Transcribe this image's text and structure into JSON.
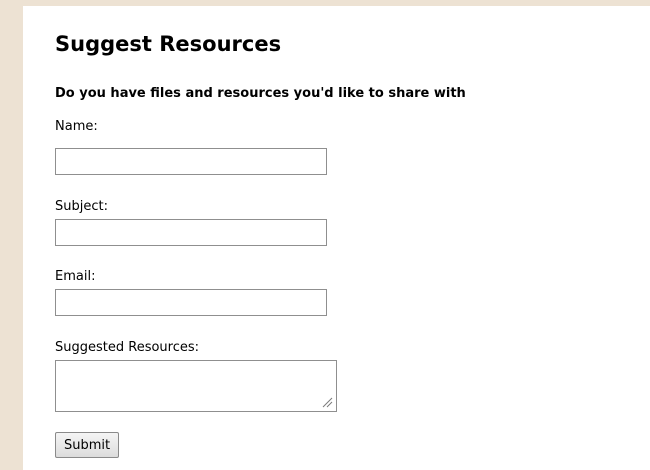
{
  "form": {
    "title": "Suggest Resources",
    "intro": "Do you have files and resources you'd like to share with",
    "fields": {
      "name": {
        "label": "Name:",
        "value": ""
      },
      "subject": {
        "label": "Subject:",
        "value": ""
      },
      "email": {
        "label": "Email:",
        "value": ""
      },
      "resources": {
        "label": "Suggested Resources:",
        "value": ""
      }
    },
    "submit_label": "Submit"
  }
}
